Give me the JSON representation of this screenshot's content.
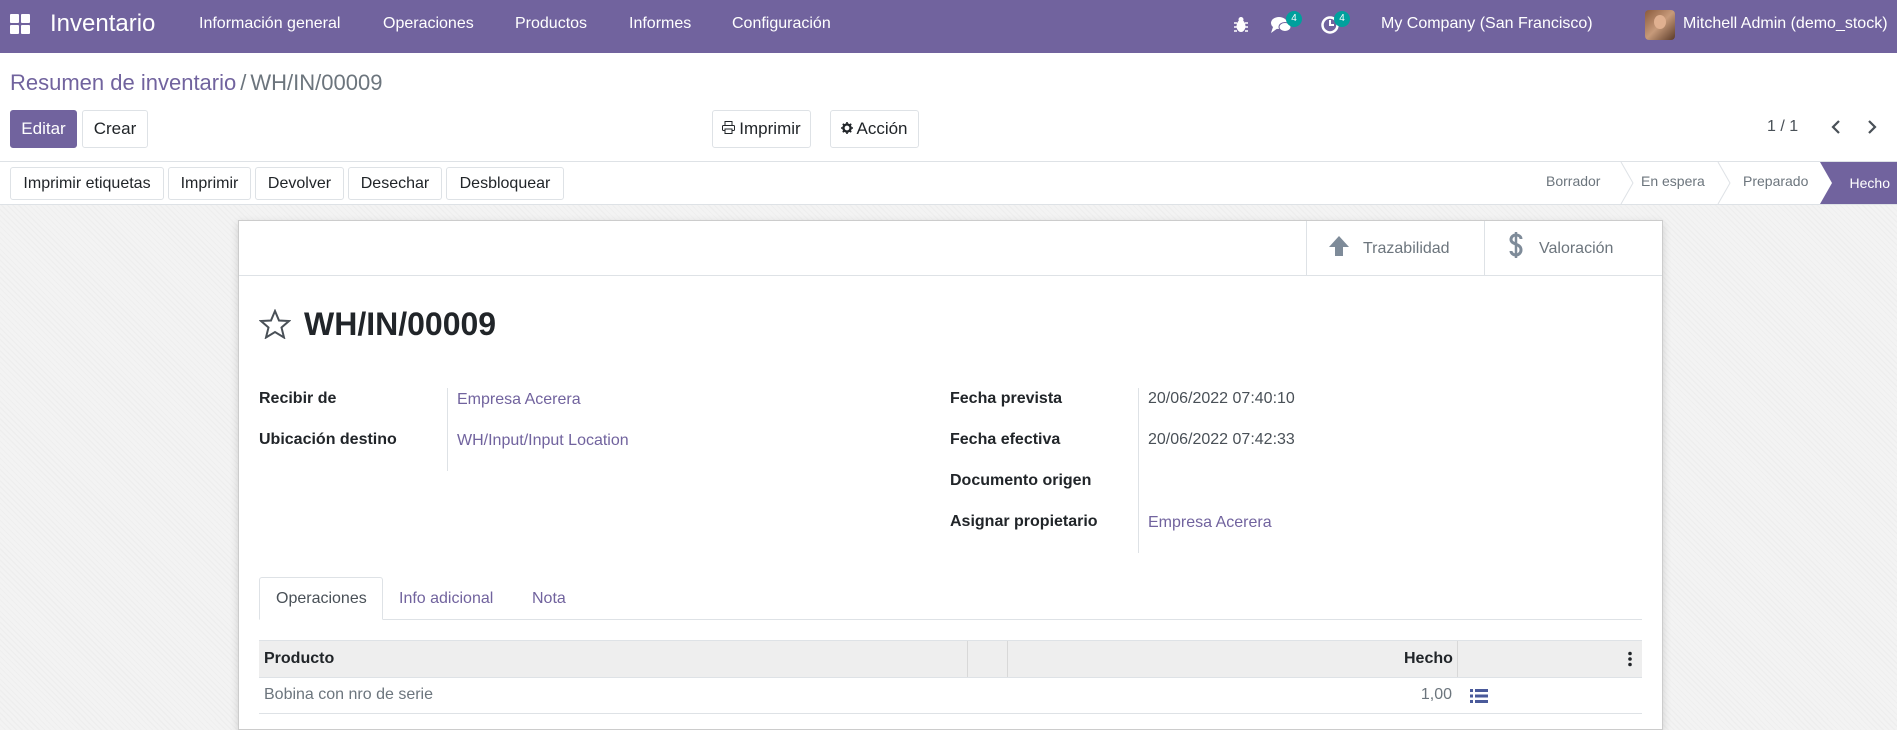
{
  "navbar": {
    "app_name": "Inventario",
    "menu": [
      "Información general",
      "Operaciones",
      "Productos",
      "Informes",
      "Configuración"
    ],
    "messages_count": "4",
    "activities_count": "4",
    "company": "My Company (San Francisco)",
    "user": "Mitchell Admin (demo_stock)"
  },
  "breadcrumb": {
    "parent": "Resumen de inventario",
    "separator": "/",
    "current": "WH/IN/00009"
  },
  "control": {
    "edit_label": "Editar",
    "create_label": "Crear",
    "print_label": "Imprimir",
    "action_label": "Acción",
    "pager": "1 / 1"
  },
  "statusbar": {
    "buttons": [
      "Imprimir etiquetas",
      "Imprimir",
      "Devolver",
      "Desechar",
      "Desbloquear"
    ],
    "stages": [
      "Borrador",
      "En espera",
      "Preparado",
      "Hecho"
    ],
    "active_stage": "Hecho"
  },
  "smart_buttons": {
    "traceability": "Trazabilidad",
    "valuation": "Valoración"
  },
  "record": {
    "name": "WH/IN/00009",
    "receive_from_label": "Recibir de",
    "receive_from": "Empresa Acerera",
    "dest_location_label": "Ubicación destino",
    "dest_location": "WH/Input/Input Location",
    "scheduled_date_label": "Fecha prevista",
    "scheduled_date": "20/06/2022 07:40:10",
    "effective_date_label": "Fecha efectiva",
    "effective_date": "20/06/2022 07:42:33",
    "origin_label": "Documento origen",
    "origin": "",
    "owner_label": "Asignar propietario",
    "owner": "Empresa Acerera"
  },
  "tabs": [
    "Operaciones",
    "Info adicional",
    "Nota"
  ],
  "table": {
    "columns": [
      "Producto",
      "Hecho"
    ],
    "rows": [
      {
        "product": "Bobina con nro de serie",
        "done": "1,00"
      }
    ]
  },
  "colors": {
    "brand": "#71639e",
    "badge": "#00a09d"
  },
  "icons": [
    "apps-icon",
    "bug-icon",
    "chat-icon",
    "clock-icon",
    "star-icon",
    "arrow-up-icon",
    "dollar-icon",
    "print-icon",
    "gear-icon",
    "chevron-left-icon",
    "chevron-right-icon",
    "list-icon",
    "kebab-icon"
  ]
}
